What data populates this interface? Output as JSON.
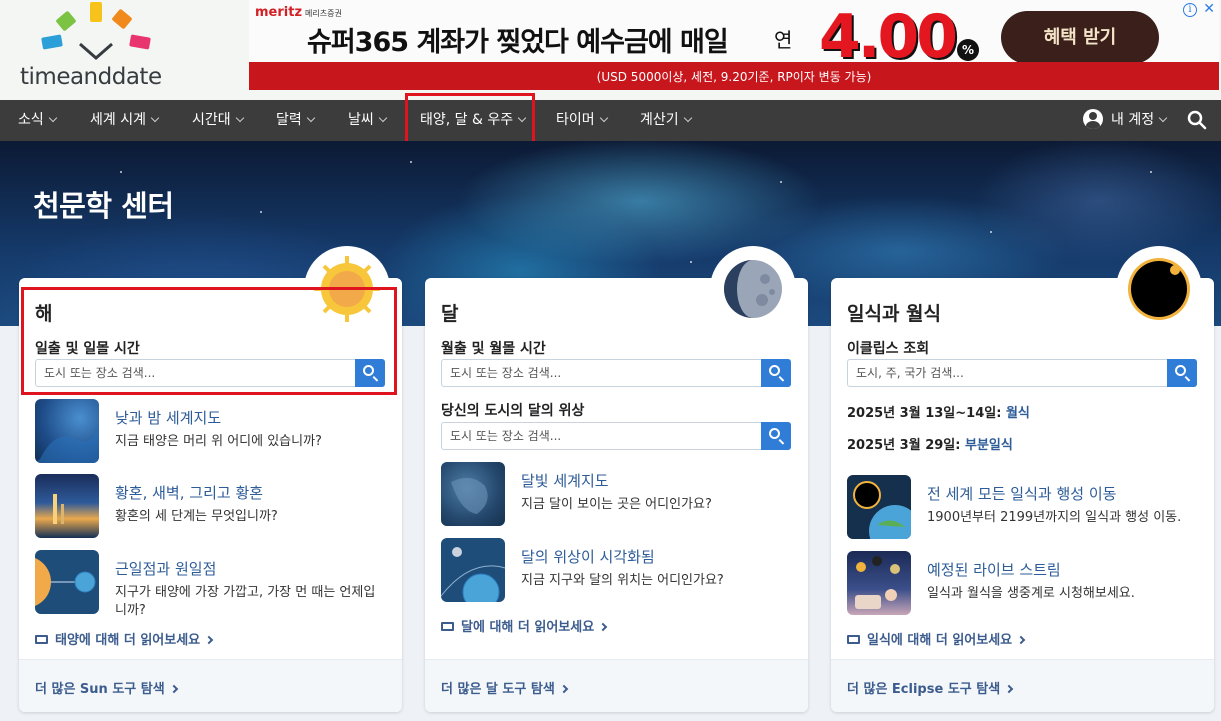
{
  "logo": {
    "text": "timeanddate"
  },
  "ad": {
    "brand": "meritz",
    "brand_sub": "메리츠증권",
    "headline": "슈퍼365 계좌가 찢었다 예수금에 매일",
    "prefix": "연",
    "rate": "4.00",
    "pct": "%",
    "cta": "혜택 받기",
    "disclaimer": "(USD 5000이상, 세전, 9.20기준, RP이자 변동 가능)",
    "info_icon": "info-icon",
    "close_icon": "close-icon"
  },
  "nav": {
    "items": [
      {
        "label": "소식"
      },
      {
        "label": "세계 시계"
      },
      {
        "label": "시간대"
      },
      {
        "label": "달력"
      },
      {
        "label": "날씨"
      },
      {
        "label": "태양, 달 & 우주"
      },
      {
        "label": "타이머"
      },
      {
        "label": "계산기"
      }
    ],
    "account": "내 계정"
  },
  "hero": {
    "title": "천문학 센터"
  },
  "sun_card": {
    "title": "해",
    "field_label": "일출 및 일몰 시간",
    "placeholder": "도시 또는 장소 검색...",
    "items": [
      {
        "title": "낮과 밤 세계지도",
        "desc": "지금 태양은 머리 위 어디에 있습니까?"
      },
      {
        "title": "황혼, 새벽, 그리고 황혼",
        "desc": "황혼의 세 단계는 무엇입니까?"
      },
      {
        "title": "근일점과 원일점",
        "desc": "지구가 태양에 가장 가깝고, 가장 먼 때는 언제입니까?"
      }
    ],
    "read_more": "태양에 대해 더 읽어보세요",
    "footer": "더 많은 Sun 도구 탐색"
  },
  "moon_card": {
    "title": "달",
    "field_label_1": "월출 및 월몰 시간",
    "placeholder_1": "도시 또는 장소 검색...",
    "field_label_2": "당신의 도시의 달의 위상",
    "placeholder_2": "도시 또는 장소 검색...",
    "items": [
      {
        "title": "달빛 세계지도",
        "desc": "지금 달이 보이는 곳은 어디인가요?"
      },
      {
        "title": "달의 위상이 시각화됨",
        "desc": "지금 지구와 달의 위치는 어디인가요?"
      }
    ],
    "read_more": "달에 대해 더 읽어보세요",
    "footer": "더 많은 달 도구 탐색"
  },
  "eclipse_card": {
    "title": "일식과 월식",
    "field_label": "이클립스 조회",
    "placeholder": "도시, 주, 국가 검색...",
    "dates": [
      {
        "date": "2025년 3월 13일~14일:",
        "type": "월식"
      },
      {
        "date": "2025년 3월 29일:",
        "type": "부분일식"
      }
    ],
    "items": [
      {
        "title": "전 세계 모든 일식과 행성 이동",
        "desc": "1900년부터 2199년까지의 일식과 행성 이동."
      },
      {
        "title": "예정된 라이브 스트림",
        "desc": "일식과 월식을 생중계로 시청해보세요."
      }
    ],
    "read_more": "일식에 대해 더 읽어보세요",
    "footer": "더 많은 Eclipse 도구 탐색"
  }
}
